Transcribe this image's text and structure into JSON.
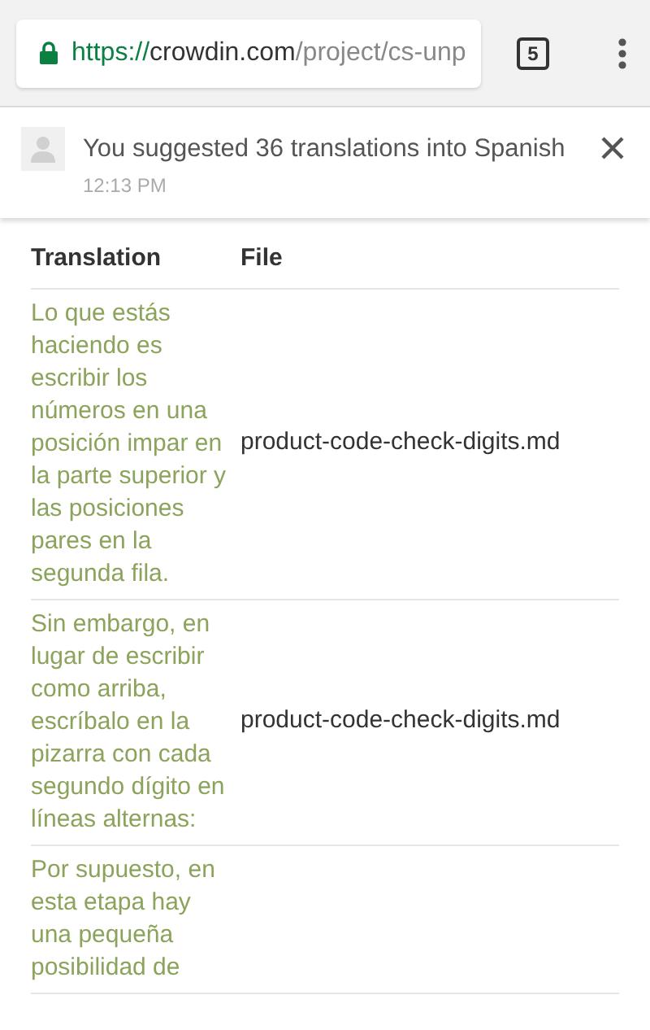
{
  "browser": {
    "url": {
      "scheme": "https://",
      "host": "crowdin.com",
      "path": "/project/cs-unp"
    },
    "tab_count": "5"
  },
  "notification": {
    "message": "You suggested 36 translations into Spanish",
    "time": "12:13 PM"
  },
  "table": {
    "columns": [
      "Translation",
      "File"
    ],
    "rows": [
      {
        "translation": "Lo que estás haciendo es escribir los números en una posición impar en la parte superior y las posiciones pares en la segunda fila.",
        "file": "product-code-check-digits.md"
      },
      {
        "translation": "Sin embargo, en lugar de escribir como arriba, escríbalo en la pizarra con cada segundo dígito en líneas alternas:",
        "file": "product-code-check-digits.md"
      },
      {
        "translation": "Por supuesto, en esta etapa hay una pequeña posibilidad de"
      }
    ]
  }
}
